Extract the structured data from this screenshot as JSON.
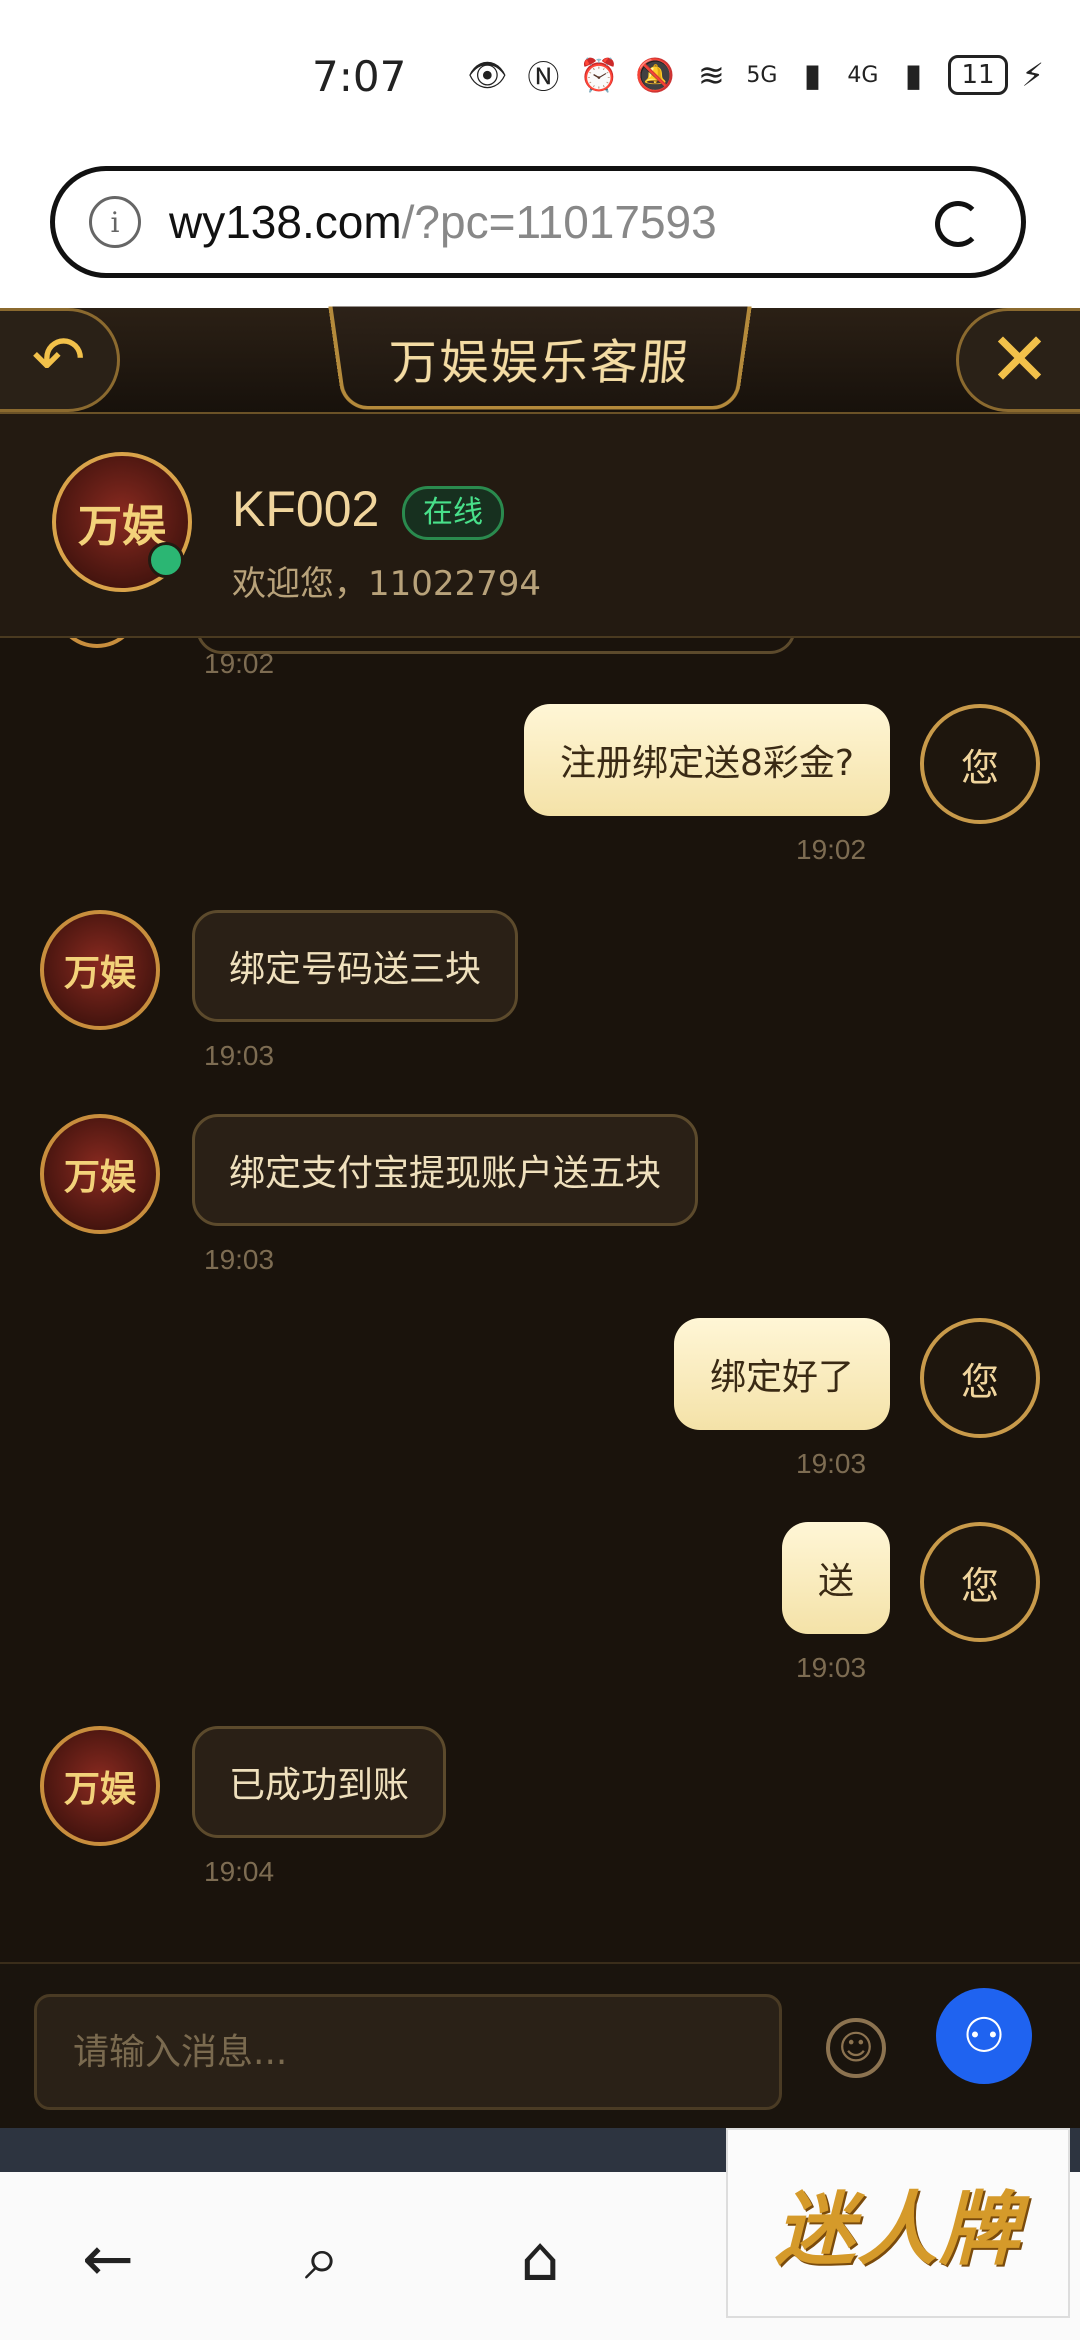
{
  "status_bar": {
    "time": "7:07",
    "signal_1": "5G",
    "signal_2": "4G",
    "battery": "11"
  },
  "browser": {
    "url_host": "wy138.com",
    "url_path": "/?pc=11017593"
  },
  "app": {
    "title": "万娱娱乐客服",
    "back_icon": "back-arrow-icon",
    "close_icon": "close-icon"
  },
  "agent": {
    "name": "KF002",
    "status": "在线",
    "welcome": "欢迎您，11022794",
    "avatar_text": "万娱"
  },
  "messages": [
    {
      "side": "left",
      "text": "",
      "time": "19:02"
    },
    {
      "side": "right",
      "text": "注册绑定送8彩金?",
      "time": "19:02",
      "avatar": "您"
    },
    {
      "side": "left",
      "text": "绑定号码送三块",
      "time": "19:03"
    },
    {
      "side": "left",
      "text": "绑定支付宝提现账户送五块",
      "time": "19:03"
    },
    {
      "side": "right",
      "text": "绑定好了",
      "time": "19:03",
      "avatar": "您"
    },
    {
      "side": "right",
      "text": "送",
      "time": "19:03",
      "avatar": "您"
    },
    {
      "side": "left",
      "text": "已成功到账",
      "time": "19:04"
    }
  ],
  "composer": {
    "placeholder": "请输入消息..."
  },
  "watermark": "迷人牌"
}
